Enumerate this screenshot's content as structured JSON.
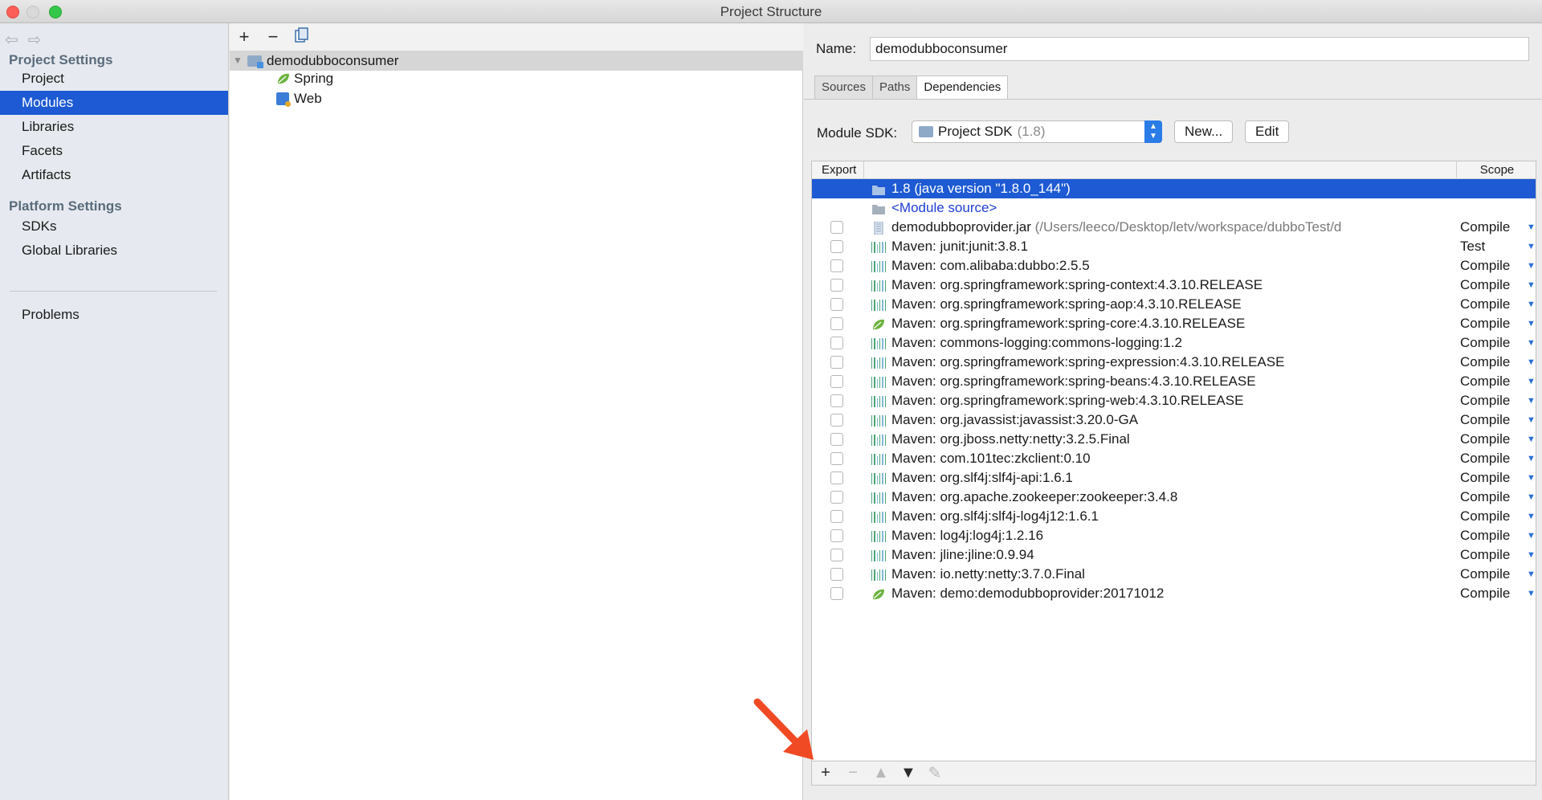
{
  "window": {
    "title": "Project Structure"
  },
  "sidebar": {
    "section_project": "Project Settings",
    "section_platform": "Platform Settings",
    "items": [
      {
        "label": "Project",
        "selected": false
      },
      {
        "label": "Modules",
        "selected": true
      },
      {
        "label": "Libraries",
        "selected": false
      },
      {
        "label": "Facets",
        "selected": false
      },
      {
        "label": "Artifacts",
        "selected": false
      }
    ],
    "platform_items": [
      {
        "label": "SDKs"
      },
      {
        "label": "Global Libraries"
      }
    ],
    "problems": "Problems"
  },
  "tree": {
    "toolbar": {
      "add": "+",
      "remove": "−",
      "copy_icon": "copy-icon"
    },
    "root": "demodubboconsumer",
    "children": [
      "Spring",
      "Web"
    ]
  },
  "module": {
    "name_label": "Name:",
    "name_value": "demodubboconsumer",
    "tabs": [
      "Sources",
      "Paths",
      "Dependencies"
    ],
    "active_tab": "Dependencies",
    "sdk_label": "Module SDK:",
    "sdk_value": "Project SDK",
    "sdk_version": "(1.8)",
    "new_button": "New...",
    "edit_button": "Edit"
  },
  "dependencies": {
    "col_export": "Export",
    "col_scope": "Scope",
    "rows": [
      {
        "name": "1.8 (java version \"1.8.0_144\")",
        "icon": "jdk-folder-icon",
        "scope": "",
        "checkbox": false,
        "selected": true
      },
      {
        "name": "<Module source>",
        "icon": "source-folder-icon",
        "scope": "",
        "checkbox": false,
        "link": true
      },
      {
        "name": "demodubboprovider.jar",
        "path": "(/Users/leeco/Desktop/letv/workspace/dubboTest/demodub",
        "icon": "jar-icon",
        "scope": "Compile",
        "checkbox": true
      },
      {
        "name": "Maven: junit:junit:3.8.1",
        "icon": "maven-library-icon",
        "scope": "Test",
        "checkbox": true
      },
      {
        "name": "Maven: com.alibaba:dubbo:2.5.5",
        "icon": "maven-library-icon",
        "scope": "Compile",
        "checkbox": true
      },
      {
        "name": "Maven: org.springframework:spring-context:4.3.10.RELEASE",
        "icon": "maven-library-icon",
        "scope": "Compile",
        "checkbox": true
      },
      {
        "name": "Maven: org.springframework:spring-aop:4.3.10.RELEASE",
        "icon": "maven-library-icon",
        "scope": "Compile",
        "checkbox": true
      },
      {
        "name": "Maven: org.springframework:spring-core:4.3.10.RELEASE",
        "icon": "spring-leaf-icon",
        "scope": "Compile",
        "checkbox": true
      },
      {
        "name": "Maven: commons-logging:commons-logging:1.2",
        "icon": "maven-library-icon",
        "scope": "Compile",
        "checkbox": true
      },
      {
        "name": "Maven: org.springframework:spring-expression:4.3.10.RELEASE",
        "icon": "maven-library-icon",
        "scope": "Compile",
        "checkbox": true
      },
      {
        "name": "Maven: org.springframework:spring-beans:4.3.10.RELEASE",
        "icon": "maven-library-icon",
        "scope": "Compile",
        "checkbox": true
      },
      {
        "name": "Maven: org.springframework:spring-web:4.3.10.RELEASE",
        "icon": "maven-library-icon",
        "scope": "Compile",
        "checkbox": true
      },
      {
        "name": "Maven: org.javassist:javassist:3.20.0-GA",
        "icon": "maven-library-icon",
        "scope": "Compile",
        "checkbox": true
      },
      {
        "name": "Maven: org.jboss.netty:netty:3.2.5.Final",
        "icon": "maven-library-icon",
        "scope": "Compile",
        "checkbox": true
      },
      {
        "name": "Maven: com.101tec:zkclient:0.10",
        "icon": "maven-library-icon",
        "scope": "Compile",
        "checkbox": true
      },
      {
        "name": "Maven: org.slf4j:slf4j-api:1.6.1",
        "icon": "maven-library-icon",
        "scope": "Compile",
        "checkbox": true
      },
      {
        "name": "Maven: org.apache.zookeeper:zookeeper:3.4.8",
        "icon": "maven-library-icon",
        "scope": "Compile",
        "checkbox": true
      },
      {
        "name": "Maven: org.slf4j:slf4j-log4j12:1.6.1",
        "icon": "maven-library-icon",
        "scope": "Compile",
        "checkbox": true
      },
      {
        "name": "Maven: log4j:log4j:1.2.16",
        "icon": "maven-library-icon",
        "scope": "Compile",
        "checkbox": true
      },
      {
        "name": "Maven: jline:jline:0.9.94",
        "icon": "maven-library-icon",
        "scope": "Compile",
        "checkbox": true
      },
      {
        "name": "Maven: io.netty:netty:3.7.0.Final",
        "icon": "maven-library-icon",
        "scope": "Compile",
        "checkbox": true
      },
      {
        "name": "Maven: demo:demodubboprovider:20171012",
        "icon": "spring-leaf-icon",
        "scope": "Compile",
        "checkbox": true
      }
    ],
    "bottom_toolbar": {
      "add": "+",
      "remove": "−"
    }
  },
  "colors": {
    "selection": "#1d5ad3",
    "maven_green": "#4aa37a",
    "spring_green": "#6cb33f",
    "annotation_arrow": "#f04a24"
  }
}
